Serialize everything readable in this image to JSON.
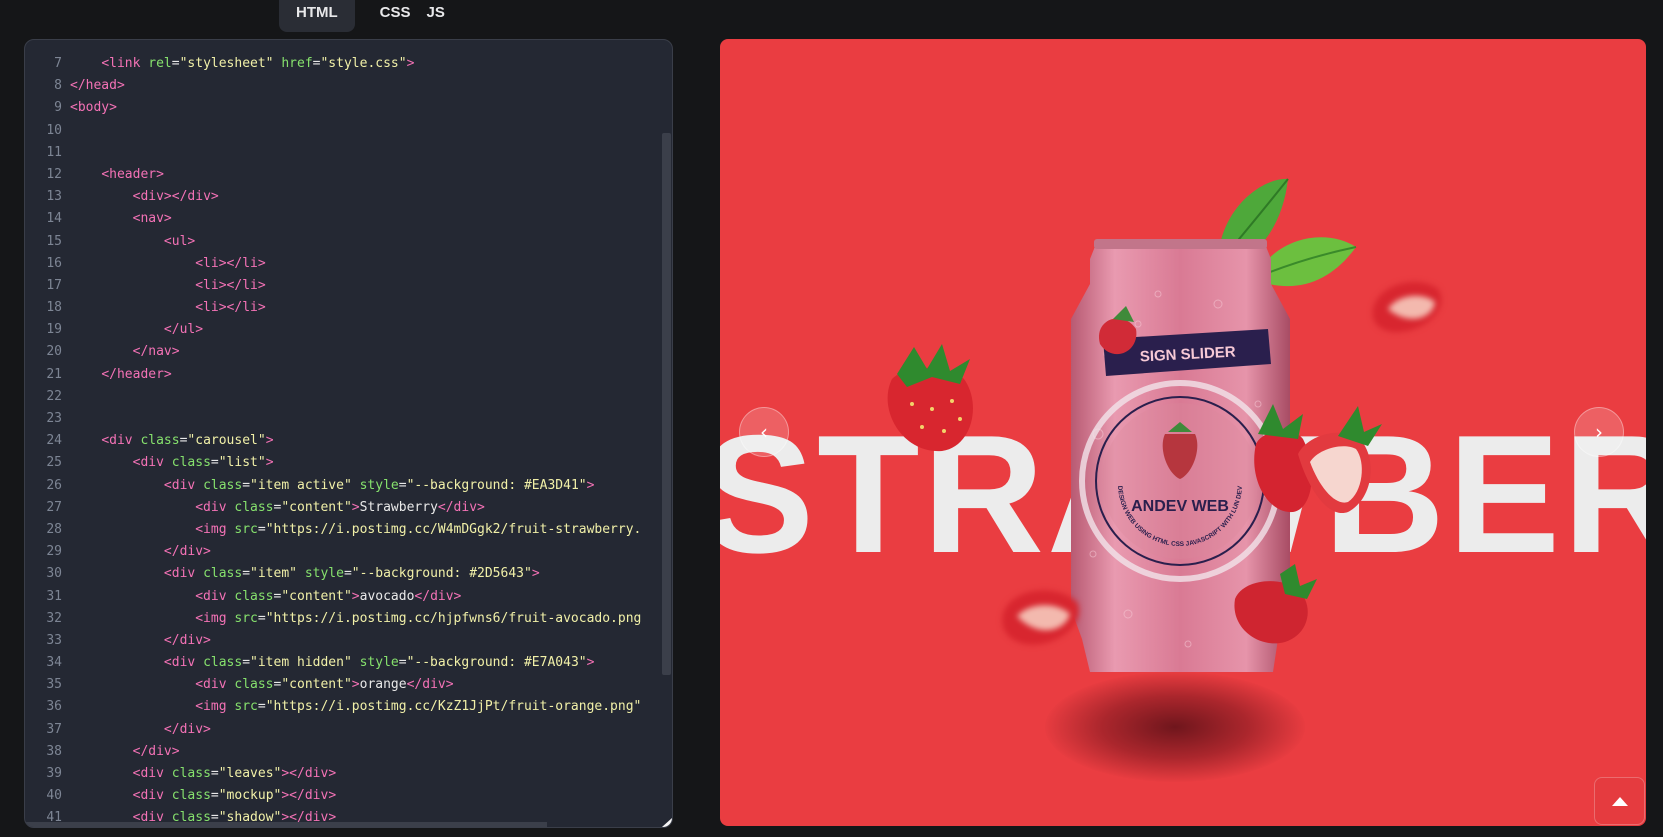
{
  "tabs": {
    "html": "HTML",
    "css": "CSS",
    "js": "JS",
    "active": "HTML"
  },
  "editor": {
    "lines": [
      {
        "n": "7",
        "parts": [
          [
            "sp",
            "    "
          ],
          [
            "tg",
            "<link "
          ],
          [
            "at",
            "rel"
          ],
          [
            "tx",
            "="
          ],
          [
            "st",
            "\"stylesheet\""
          ],
          [
            "tx",
            " "
          ],
          [
            "at",
            "href"
          ],
          [
            "tx",
            "="
          ],
          [
            "st",
            "\"style.css\""
          ],
          [
            "tg",
            ">"
          ]
        ]
      },
      {
        "n": "8",
        "parts": [
          [
            "tg",
            "</head>"
          ]
        ]
      },
      {
        "n": "9",
        "parts": [
          [
            "tg",
            "<body>"
          ]
        ]
      },
      {
        "n": "10",
        "parts": []
      },
      {
        "n": "11",
        "parts": []
      },
      {
        "n": "12",
        "parts": [
          [
            "sp",
            "    "
          ],
          [
            "tg",
            "<header>"
          ]
        ]
      },
      {
        "n": "13",
        "parts": [
          [
            "sp",
            "        "
          ],
          [
            "tg",
            "<div></div>"
          ]
        ]
      },
      {
        "n": "14",
        "parts": [
          [
            "sp",
            "        "
          ],
          [
            "tg",
            "<nav>"
          ]
        ]
      },
      {
        "n": "15",
        "parts": [
          [
            "sp",
            "            "
          ],
          [
            "tg",
            "<ul>"
          ]
        ]
      },
      {
        "n": "16",
        "parts": [
          [
            "sp",
            "                "
          ],
          [
            "tg",
            "<li></li>"
          ]
        ]
      },
      {
        "n": "17",
        "parts": [
          [
            "sp",
            "                "
          ],
          [
            "tg",
            "<li></li>"
          ]
        ]
      },
      {
        "n": "18",
        "parts": [
          [
            "sp",
            "                "
          ],
          [
            "tg",
            "<li></li>"
          ]
        ]
      },
      {
        "n": "19",
        "parts": [
          [
            "sp",
            "            "
          ],
          [
            "tg",
            "</ul>"
          ]
        ]
      },
      {
        "n": "20",
        "parts": [
          [
            "sp",
            "        "
          ],
          [
            "tg",
            "</nav>"
          ]
        ]
      },
      {
        "n": "21",
        "parts": [
          [
            "sp",
            "    "
          ],
          [
            "tg",
            "</header>"
          ]
        ]
      },
      {
        "n": "22",
        "parts": []
      },
      {
        "n": "23",
        "parts": []
      },
      {
        "n": "24",
        "parts": [
          [
            "sp",
            "    "
          ],
          [
            "tg",
            "<div "
          ],
          [
            "at",
            "class"
          ],
          [
            "tx",
            "="
          ],
          [
            "st",
            "\"carousel\""
          ],
          [
            "tg",
            ">"
          ]
        ]
      },
      {
        "n": "25",
        "parts": [
          [
            "sp",
            "        "
          ],
          [
            "tg",
            "<div "
          ],
          [
            "at",
            "class"
          ],
          [
            "tx",
            "="
          ],
          [
            "st",
            "\"list\""
          ],
          [
            "tg",
            ">"
          ]
        ]
      },
      {
        "n": "26",
        "parts": [
          [
            "sp",
            "            "
          ],
          [
            "tg",
            "<div "
          ],
          [
            "at",
            "class"
          ],
          [
            "tx",
            "="
          ],
          [
            "st",
            "\"item active\""
          ],
          [
            "tx",
            " "
          ],
          [
            "at",
            "style"
          ],
          [
            "tx",
            "="
          ],
          [
            "st",
            "\"--background: #EA3D41\""
          ],
          [
            "tg",
            ">"
          ]
        ]
      },
      {
        "n": "27",
        "parts": [
          [
            "sp",
            "                "
          ],
          [
            "tg",
            "<div "
          ],
          [
            "at",
            "class"
          ],
          [
            "tx",
            "="
          ],
          [
            "st",
            "\"content\""
          ],
          [
            "tg",
            ">"
          ],
          [
            "tx",
            "Strawberry"
          ],
          [
            "tg",
            "</div>"
          ]
        ]
      },
      {
        "n": "28",
        "parts": [
          [
            "sp",
            "                "
          ],
          [
            "tg",
            "<img "
          ],
          [
            "at",
            "src"
          ],
          [
            "tx",
            "="
          ],
          [
            "st",
            "\"https://i.postimg.cc/W4mDGgk2/fruit-strawberry."
          ]
        ]
      },
      {
        "n": "29",
        "parts": [
          [
            "sp",
            "            "
          ],
          [
            "tg",
            "</div>"
          ]
        ]
      },
      {
        "n": "30",
        "parts": [
          [
            "sp",
            "            "
          ],
          [
            "tg",
            "<div "
          ],
          [
            "at",
            "class"
          ],
          [
            "tx",
            "="
          ],
          [
            "st",
            "\"item\""
          ],
          [
            "tx",
            " "
          ],
          [
            "at",
            "style"
          ],
          [
            "tx",
            "="
          ],
          [
            "st",
            "\"--background: #2D5643\""
          ],
          [
            "tg",
            ">"
          ]
        ]
      },
      {
        "n": "31",
        "parts": [
          [
            "sp",
            "                "
          ],
          [
            "tg",
            "<div "
          ],
          [
            "at",
            "class"
          ],
          [
            "tx",
            "="
          ],
          [
            "st",
            "\"content\""
          ],
          [
            "tg",
            ">"
          ],
          [
            "tx",
            "avocado"
          ],
          [
            "tg",
            "</div>"
          ]
        ]
      },
      {
        "n": "32",
        "parts": [
          [
            "sp",
            "                "
          ],
          [
            "tg",
            "<img "
          ],
          [
            "at",
            "src"
          ],
          [
            "tx",
            "="
          ],
          [
            "st",
            "\"https://i.postimg.cc/hjpfwns6/fruit-avocado.png"
          ]
        ]
      },
      {
        "n": "33",
        "parts": [
          [
            "sp",
            "            "
          ],
          [
            "tg",
            "</div>"
          ]
        ]
      },
      {
        "n": "34",
        "parts": [
          [
            "sp",
            "            "
          ],
          [
            "tg",
            "<div "
          ],
          [
            "at",
            "class"
          ],
          [
            "tx",
            "="
          ],
          [
            "st",
            "\"item hidden\""
          ],
          [
            "tx",
            " "
          ],
          [
            "at",
            "style"
          ],
          [
            "tx",
            "="
          ],
          [
            "st",
            "\"--background: #E7A043\""
          ],
          [
            "tg",
            ">"
          ]
        ]
      },
      {
        "n": "35",
        "parts": [
          [
            "sp",
            "                "
          ],
          [
            "tg",
            "<div "
          ],
          [
            "at",
            "class"
          ],
          [
            "tx",
            "="
          ],
          [
            "st",
            "\"content\""
          ],
          [
            "tg",
            ">"
          ],
          [
            "tx",
            "orange"
          ],
          [
            "tg",
            "</div>"
          ]
        ]
      },
      {
        "n": "36",
        "parts": [
          [
            "sp",
            "                "
          ],
          [
            "tg",
            "<img "
          ],
          [
            "at",
            "src"
          ],
          [
            "tx",
            "="
          ],
          [
            "st",
            "\"https://i.postimg.cc/KzZ1JjPt/fruit-orange.png\""
          ]
        ]
      },
      {
        "n": "37",
        "parts": [
          [
            "sp",
            "            "
          ],
          [
            "tg",
            "</div>"
          ]
        ]
      },
      {
        "n": "38",
        "parts": [
          [
            "sp",
            "        "
          ],
          [
            "tg",
            "</div>"
          ]
        ]
      },
      {
        "n": "39",
        "parts": [
          [
            "sp",
            "        "
          ],
          [
            "tg",
            "<div "
          ],
          [
            "at",
            "class"
          ],
          [
            "tx",
            "="
          ],
          [
            "st",
            "\"leaves\""
          ],
          [
            "tg",
            "></div>"
          ]
        ]
      },
      {
        "n": "40",
        "parts": [
          [
            "sp",
            "        "
          ],
          [
            "tg",
            "<div "
          ],
          [
            "at",
            "class"
          ],
          [
            "tx",
            "="
          ],
          [
            "st",
            "\"mockup\""
          ],
          [
            "tg",
            "></div>"
          ]
        ]
      },
      {
        "n": "41",
        "parts": [
          [
            "sp",
            "        "
          ],
          [
            "tg",
            "<div "
          ],
          [
            "at",
            "class"
          ],
          [
            "tx",
            "="
          ],
          [
            "st",
            "\"shadow\""
          ],
          [
            "tg",
            "></div>"
          ]
        ]
      }
    ]
  },
  "preview": {
    "background": "#EA3D41",
    "title": "STRAWBERRY",
    "can": {
      "banner": "SIGN SLIDER",
      "brand": "ANDEV WEB",
      "ring_text": "DESIGN WEB USING HTML CSS JAVASCRIPT WITH LUN DEV"
    },
    "prev_icon": "chevron-left-icon",
    "next_icon": "chevron-right-icon",
    "scroll_top_icon": "caret-up-icon"
  }
}
